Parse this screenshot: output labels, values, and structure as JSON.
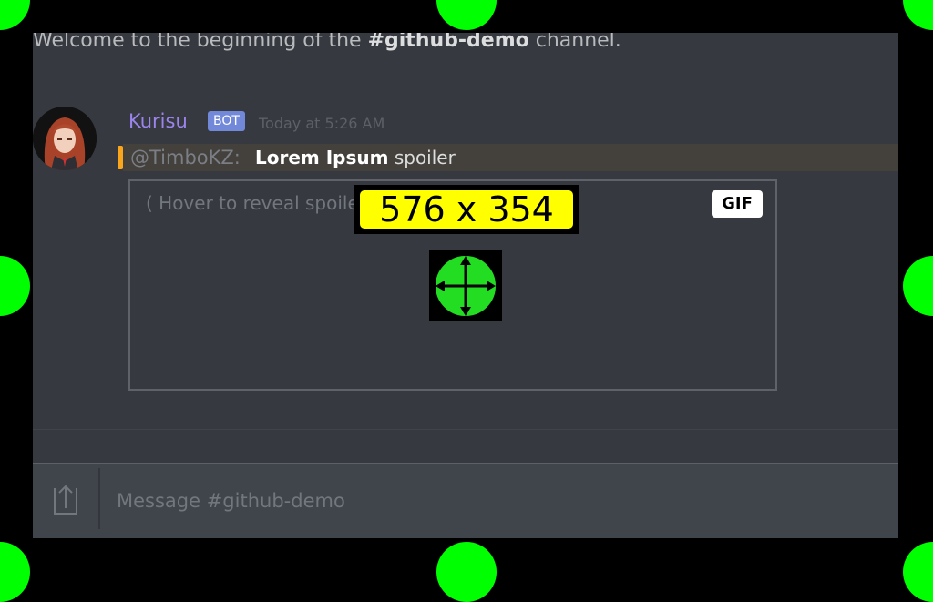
{
  "channel": {
    "welcome_prefix": "Welcome to the beginning of the ",
    "name": "#github-demo",
    "welcome_suffix": " channel."
  },
  "message": {
    "username": "Kurisu",
    "badge": "BOT",
    "timestamp": "Today at 5:26 AM",
    "reply": {
      "mention": "@TimboKZ:",
      "bold": "Lorem Ipsum",
      "text": "spoiler"
    },
    "spoiler_hint": "( Hover to reveal spoiler )",
    "gif_label": "GIF",
    "avatar_icon": "anime-avatar"
  },
  "overlay": {
    "dimensions": "576 x 354",
    "move_icon": "move-crosshair-icon",
    "handle_color": "#00ff00"
  },
  "composer": {
    "placeholder": "Message #github-demo",
    "upload_icon": "upload-icon"
  },
  "colors": {
    "background": "#36393f",
    "username": "#9b84ec",
    "badge": "#7289da",
    "reply_accent": "#faa61a"
  }
}
